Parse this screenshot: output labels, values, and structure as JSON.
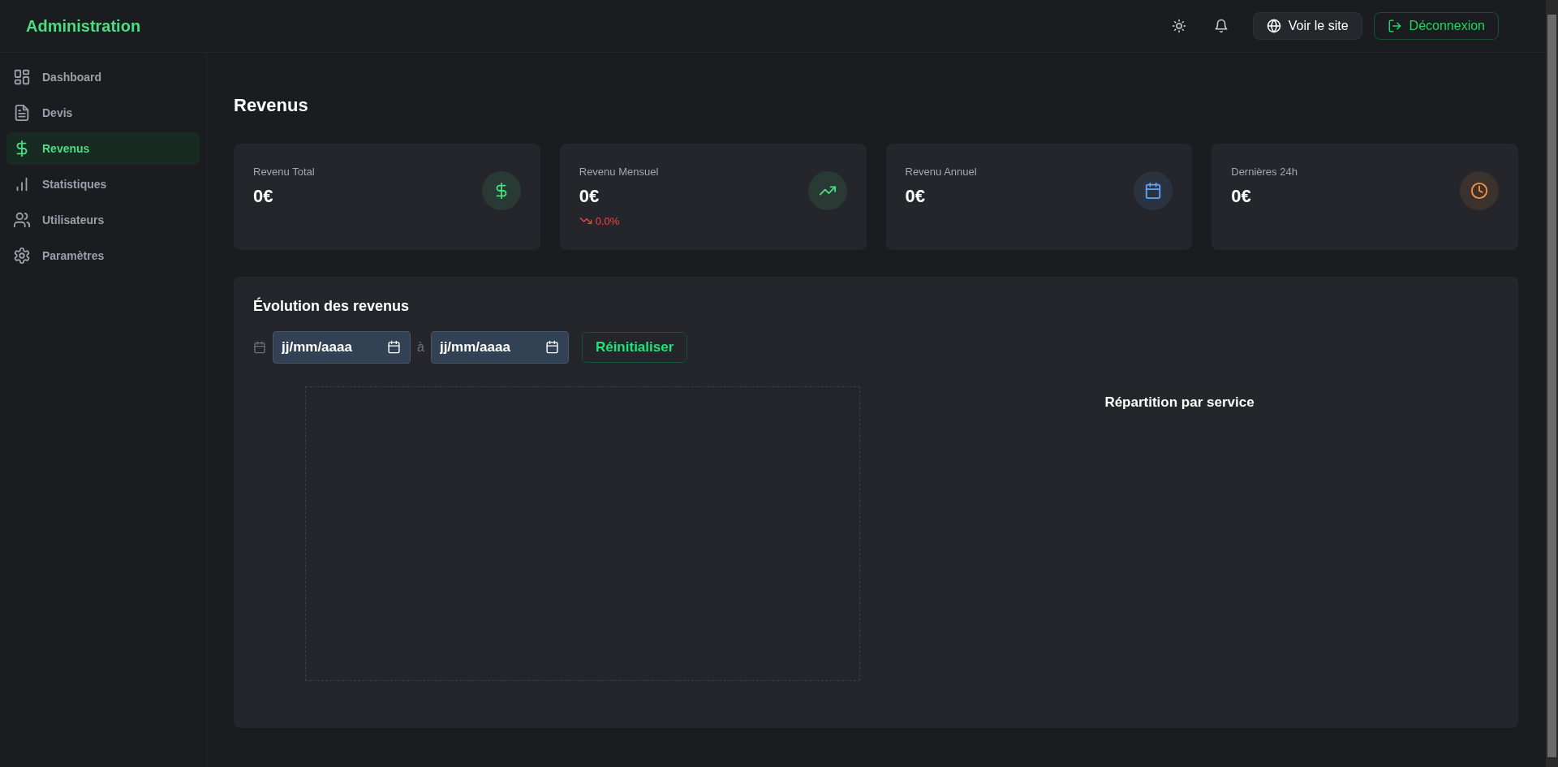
{
  "header": {
    "title": "Administration",
    "view_site": "Voir le site",
    "logout": "Déconnexion"
  },
  "sidebar": {
    "items": [
      {
        "label": "Dashboard",
        "selected": false
      },
      {
        "label": "Devis",
        "selected": false
      },
      {
        "label": "Revenus",
        "selected": true
      },
      {
        "label": "Statistiques",
        "selected": false
      },
      {
        "label": "Utilisateurs",
        "selected": false
      },
      {
        "label": "Paramètres",
        "selected": false
      }
    ]
  },
  "page_title": "Revenus",
  "cards": [
    {
      "label": "Revenu Total",
      "value": "0€",
      "color": "#4ade80"
    },
    {
      "label": "Revenu Mensuel",
      "value": "0€",
      "color": "#4ade80",
      "trend": {
        "text": "0.0%",
        "falling": true
      }
    },
    {
      "label": "Revenu Annuel",
      "value": "0€",
      "color": "#60a5fa"
    },
    {
      "label": "Dernières 24h",
      "value": "0€",
      "color": "#fb923c"
    }
  ],
  "revenue_panel": {
    "title": "Évolution des revenus",
    "from": {
      "placeholder": "jj/mm/aaaa"
    },
    "separator": "à",
    "to": {
      "placeholder": "jj/mm/aaaa"
    },
    "reset": "Réinitialiser",
    "breakdown_title": "Répartition par service"
  }
}
